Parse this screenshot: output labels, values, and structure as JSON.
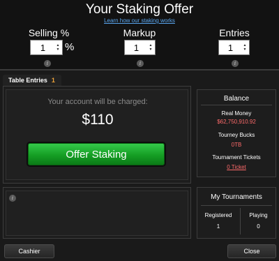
{
  "header": {
    "title": "Your Staking Offer",
    "learn_link": "Learn how our staking works"
  },
  "controls": {
    "selling": {
      "label": "Selling %",
      "value": "1",
      "suffix": "%"
    },
    "markup": {
      "label": "Markup",
      "value": "1"
    },
    "entries": {
      "label": "Entries",
      "value": "1"
    }
  },
  "tab": {
    "label": "Table Entries",
    "count": "1"
  },
  "charge": {
    "label": "Your account will be charged:",
    "amount": "$110",
    "offer_button": "Offer Staking"
  },
  "balance": {
    "title": "Balance",
    "real_money_label": "Real Money",
    "real_money_value": "$62,750,910.92",
    "tourney_bucks_label": "Tourney Bucks",
    "tourney_bucks_value": "0TB",
    "tourney_tickets_label": "Tournament Tickets",
    "tourney_tickets_value": "0 Ticket"
  },
  "my_tournaments": {
    "title": "My Tournaments",
    "registered_label": "Registered",
    "registered_value": "1",
    "playing_label": "Playing",
    "playing_value": "0"
  },
  "footer": {
    "cashier": "Cashier",
    "close": "Close"
  },
  "icons": {
    "info": "info-icon",
    "spin_up": "spin-up-icon",
    "spin_down": "spin-down-icon"
  },
  "colors": {
    "accent_link": "#5aa6ef",
    "money_red": "#ff6b6b",
    "count_orange": "#f0a43a",
    "offer_green": "#159e24"
  }
}
